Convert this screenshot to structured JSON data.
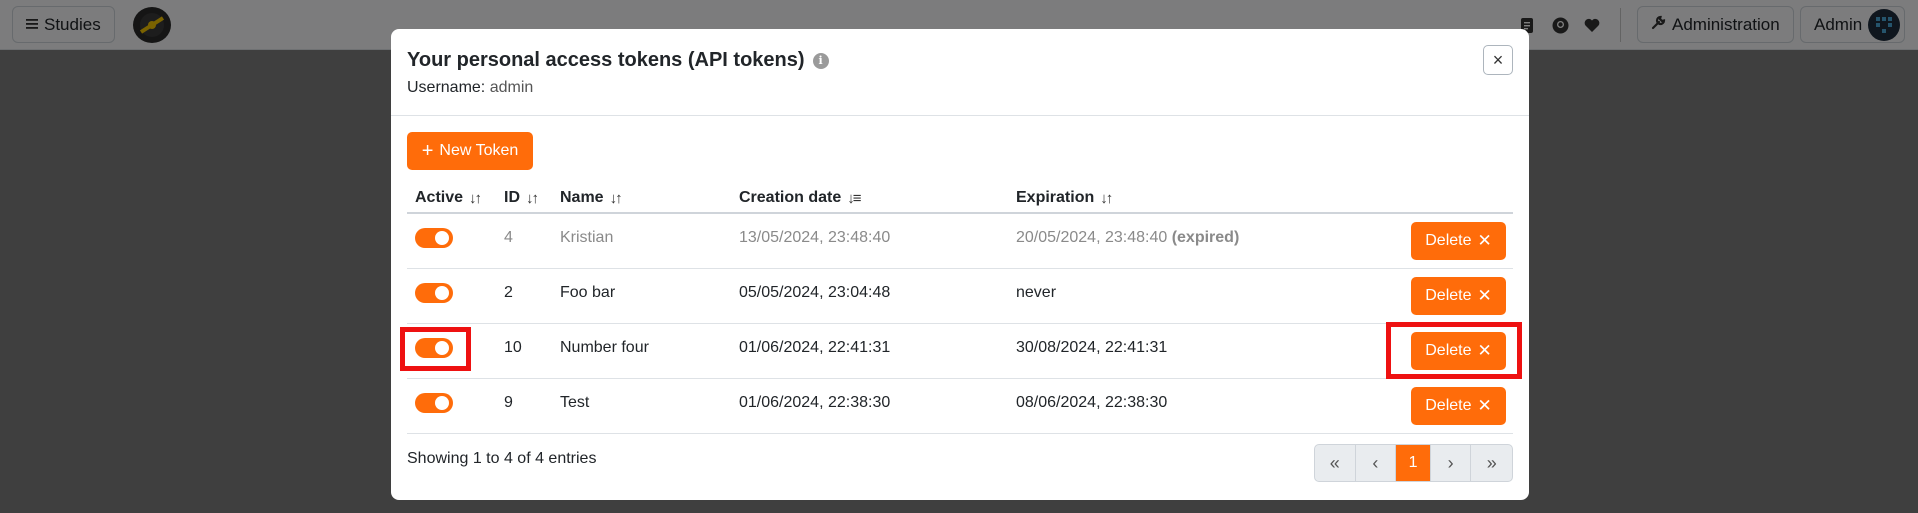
{
  "navbar": {
    "studies_label": "Studies",
    "administration_label": "Administration",
    "user_label": "Admin"
  },
  "modal": {
    "title": "Your personal access tokens (API tokens)",
    "info_glyph": "i",
    "username_label": "Username:",
    "username_value": "admin",
    "close_glyph": "×",
    "new_token_label": "New Token",
    "columns": [
      "Active",
      "ID",
      "Name",
      "Creation date",
      "Expiration"
    ],
    "rows": [
      {
        "active": true,
        "id": "4",
        "name": "Kristian",
        "created": "13/05/2024, 23:48:40",
        "expiration": "20/05/2024, 23:48:40",
        "expired_tag": "(expired)",
        "delete_label": "Delete"
      },
      {
        "active": true,
        "id": "2",
        "name": "Foo bar",
        "created": "05/05/2024, 23:04:48",
        "expiration": "never",
        "delete_label": "Delete"
      },
      {
        "active": true,
        "id": "10",
        "name": "Number four",
        "created": "01/06/2024, 22:41:31",
        "expiration": "30/08/2024, 22:41:31",
        "delete_label": "Delete"
      },
      {
        "active": true,
        "id": "9",
        "name": "Test",
        "created": "01/06/2024, 22:38:30",
        "expiration": "08/06/2024, 22:38:30",
        "delete_label": "Delete"
      }
    ],
    "footer_text": "Showing 1 to 4 of 4 entries",
    "pagination": {
      "first": "«",
      "prev": "‹",
      "current": "1",
      "next": "›",
      "last": "»"
    }
  },
  "colors": {
    "accent": "#ff6c0a",
    "highlight": "#ee1111"
  },
  "icons": [
    "menu-icon",
    "logo-icon",
    "docs-icon",
    "github-icon",
    "heart-icon",
    "wrench-icon",
    "avatar-icon",
    "info-icon",
    "close-icon",
    "plus-icon",
    "sort-icon",
    "sort-desc-icon",
    "x-icon"
  ]
}
